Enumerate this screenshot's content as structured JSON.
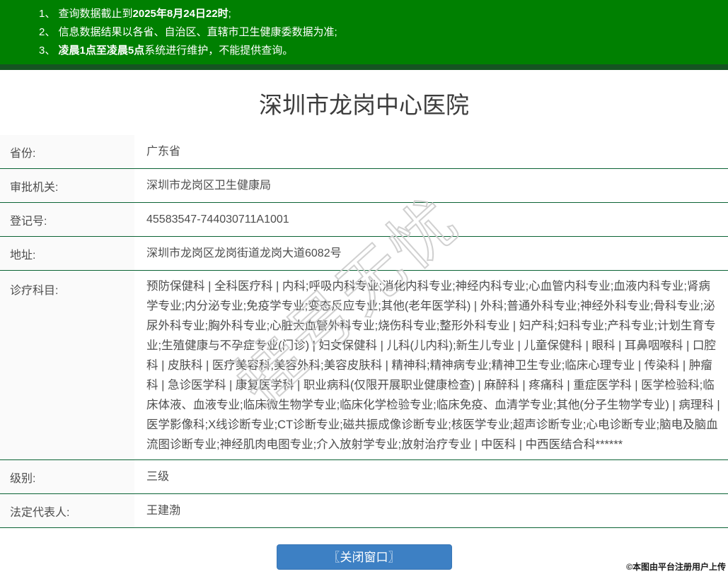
{
  "notice": {
    "items": [
      {
        "prefix": "1、 查询数据截止到",
        "bold": "2025年8月24日22时",
        "suffix": ";"
      },
      {
        "prefix": "2、 信息数据结果以各省、自治区、直辖市卫生健康委数据为准;",
        "bold": "",
        "suffix": ""
      },
      {
        "prefix": "3、 ",
        "bold": "凌晨1点至凌晨5点",
        "suffix": "系统进行维护，不能提供查询。"
      }
    ]
  },
  "page": {
    "title": "深圳市龙岗中心医院"
  },
  "table": {
    "rows": [
      {
        "label": "省份:",
        "value": "广东省"
      },
      {
        "label": "审批机关:",
        "value": "深圳市龙岗区卫生健康局"
      },
      {
        "label": "登记号:",
        "value": "45583547-744030711A1001"
      },
      {
        "label": "地址:",
        "value": "深圳市龙岗区龙岗街道龙岗大道6082号"
      },
      {
        "label": "诊疗科目:",
        "value": "预防保健科 | 全科医疗科 | 内科;呼吸内科专业;消化内科专业;神经内科专业;心血管内科专业;血液内科专业;肾病学专业;内分泌专业;免疫学专业;变态反应专业;其他(老年医学科) | 外科;普通外科专业;神经外科专业;骨科专业;泌尿外科专业;胸外科专业;心脏大血管外科专业;烧伤科专业;整形外科专业 | 妇产科;妇科专业;产科专业;计划生育专业;生殖健康与不孕症专业(门诊) | 妇女保健科 | 儿科(儿内科);新生儿专业 | 儿童保健科 | 眼科 | 耳鼻咽喉科 | 口腔科 | 皮肤科 | 医疗美容科;美容外科;美容皮肤科 | 精神科;精神病专业;精神卫生专业;临床心理专业 | 传染科 | 肿瘤科 | 急诊医学科 | 康复医学科 | 职业病科(仅限开展职业健康检查) | 麻醉科 | 疼痛科 | 重症医学科 | 医学检验科;临床体液、血液专业;临床微生物学专业;临床化学检验专业;临床免疫、血清学专业;其他(分子生物学专业) | 病理科 | 医学影像科;X线诊断专业;CT诊断专业;磁共振成像诊断专业;核医学专业;超声诊断专业;心电诊断专业;脑电及脑血流图诊断专业;神经肌肉电图专业;介入放射学专业;放射治疗专业 | 中医科 | 中西医结合科******"
      },
      {
        "label": "级别:",
        "value": "三级"
      },
      {
        "label": "法定代表人:",
        "value": "王建渤"
      }
    ]
  },
  "watermark": {
    "text": "挂号无忧"
  },
  "footer": {
    "close_button_label": "〖关闭窗口〗",
    "credit": "©本图由平台注册用户上传"
  },
  "colors": {
    "header_green": "#008001",
    "header_strip_green": "#155422",
    "divider_green": "#0a6334",
    "button_blue": "#3d80c4",
    "label_bg": "#fafafa",
    "watermark_gray": "#cccccc"
  }
}
